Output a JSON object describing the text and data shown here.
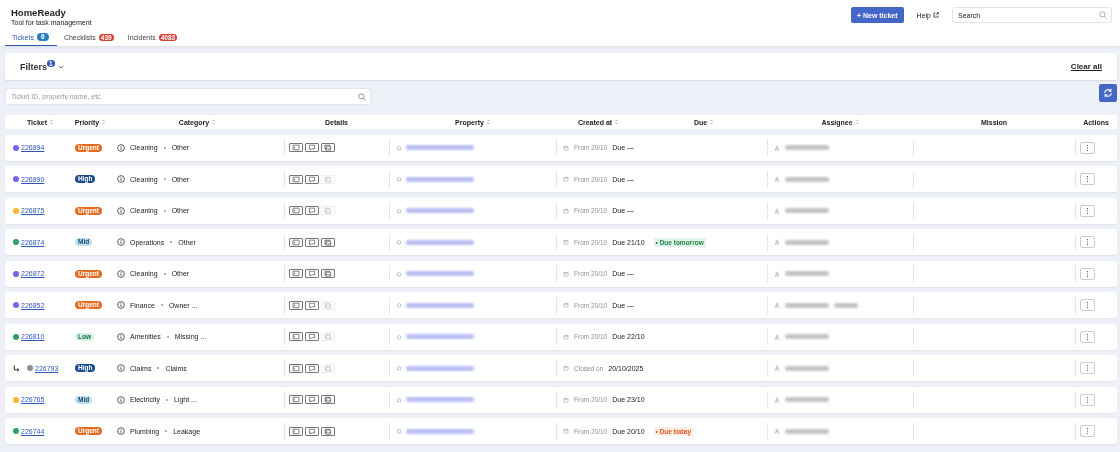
{
  "app": {
    "title": "HomeReady",
    "subtitle": "Tool for task management"
  },
  "header_actions": {
    "new_button": "+ New ticket",
    "help": "Help",
    "search": {
      "placeholder": "Search"
    }
  },
  "tabs": [
    {
      "label": "Tickets",
      "count": "6",
      "selected": true
    },
    {
      "label": "Checklists",
      "count": "439",
      "selected": false
    },
    {
      "label": "Incidents",
      "count": "4083",
      "selected": false
    }
  ],
  "filters": {
    "title": "Filters",
    "count": "1",
    "clear": "Clear all"
  },
  "ticket_search": {
    "placeholder": "Ticket ID, property name, etc."
  },
  "table": {
    "columns": [
      {
        "label": "Ticket",
        "sortable": true
      },
      {
        "label": "Priority",
        "sortable": true
      },
      {
        "label": "Category",
        "sortable": true
      },
      {
        "label": "Details",
        "sortable": false
      },
      {
        "label": "Property",
        "sortable": true
      },
      {
        "label": "Created at",
        "sortable": true
      },
      {
        "label": "Due",
        "sortable": true
      },
      {
        "label": "Assignee",
        "sortable": true
      },
      {
        "label": "Mission",
        "sortable": false
      },
      {
        "label": "Actions",
        "sortable": false
      }
    ],
    "rows": [
      {
        "ticket": "226894",
        "color": "#7b61e8",
        "linked": false,
        "priority": {
          "label": "Urgent",
          "kind": "urgent"
        },
        "category": "Cleaning",
        "subcategory": "Other",
        "photos": true,
        "created": "From 20/10",
        "due": "Due —",
        "extra_assignee": false
      },
      {
        "ticket": "226890",
        "color": "#7b61e8",
        "linked": false,
        "priority": {
          "label": "High",
          "kind": "high"
        },
        "category": "Cleaning",
        "subcategory": "Other",
        "photos": false,
        "created": "From 20/10",
        "due": "Due —",
        "extra_assignee": false
      },
      {
        "ticket": "226875",
        "color": "#f5b82e",
        "linked": false,
        "priority": {
          "label": "Urgent",
          "kind": "urgent"
        },
        "category": "Cleaning",
        "subcategory": "Other",
        "photos": false,
        "created": "From 20/10",
        "due": "Due —",
        "extra_assignee": false
      },
      {
        "ticket": "226874",
        "color": "#2e9e6b",
        "linked": false,
        "priority": {
          "label": "Mid",
          "kind": "mid"
        },
        "category": "Operations",
        "subcategory": "Other",
        "photos": true,
        "created": "From 20/10",
        "due": "Due 21/10",
        "due_tag": {
          "label": "• Due tomorrow",
          "kind": "soon"
        },
        "extra_assignee": false
      },
      {
        "ticket": "226872",
        "color": "#7b61e8",
        "linked": false,
        "priority": {
          "label": "Urgent",
          "kind": "urgent"
        },
        "category": "Cleaning",
        "subcategory": "Other",
        "photos": true,
        "created": "From 20/10",
        "due": "Due —",
        "extra_assignee": false
      },
      {
        "ticket": "226852",
        "color": "#7b61e8",
        "linked": false,
        "priority": {
          "label": "Urgent",
          "kind": "urgent"
        },
        "category": "Finance",
        "subcategory": "Owner ...",
        "photos": false,
        "created": "From 20/10",
        "due": "Due —",
        "extra_assignee": true
      },
      {
        "ticket": "226810",
        "color": "#2e9e6b",
        "linked": false,
        "priority": {
          "label": "Low",
          "kind": "low"
        },
        "category": "Amenities",
        "subcategory": "Missing ...",
        "photos": false,
        "created": "From 20/10",
        "due": "Due 22/10",
        "extra_assignee": false
      },
      {
        "ticket": "226793",
        "color": "#8a8f9c",
        "linked": true,
        "priority": {
          "label": "High",
          "kind": "high"
        },
        "category": "Claims",
        "subcategory": "Claims",
        "photos": false,
        "created": "Closed on",
        "due": "20/10/2025",
        "extra_assignee": false
      },
      {
        "ticket": "226765",
        "color": "#f5b82e",
        "linked": false,
        "priority": {
          "label": "Mid",
          "kind": "mid"
        },
        "category": "Electricity",
        "subcategory": "Light ...",
        "photos": true,
        "created": "From 20/10",
        "due": "Due 23/10",
        "extra_assignee": false
      },
      {
        "ticket": "226744",
        "color": "#2e9e6b",
        "linked": false,
        "priority": {
          "label": "Urgent",
          "kind": "urgent"
        },
        "category": "Plumbing",
        "subcategory": "Leakage",
        "photos": true,
        "created": "From 20/10",
        "due": "Due 20/10",
        "due_tag": {
          "label": "• Due today",
          "kind": "today"
        },
        "extra_assignee": false
      }
    ]
  }
}
